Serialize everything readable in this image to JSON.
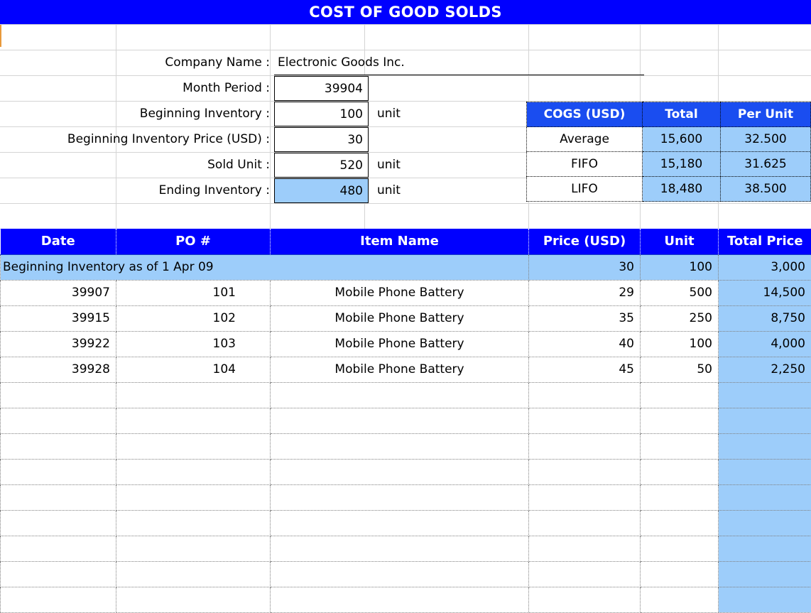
{
  "title": "COST OF GOOD SOLDS",
  "form": {
    "rows": [
      {
        "label": "Company Name :",
        "value": "Electronic Goods Inc.",
        "unit": "",
        "style": "text"
      },
      {
        "label": "Month Period :",
        "value": "39904",
        "unit": "",
        "style": "num"
      },
      {
        "label": "Beginning Inventory :",
        "value": "100",
        "unit": "unit",
        "style": "num"
      },
      {
        "label": "Beginning Inventory Price (USD) :",
        "value": "30",
        "unit": "",
        "style": "num"
      },
      {
        "label": "Sold Unit :",
        "value": "520",
        "unit": "unit",
        "style": "num"
      },
      {
        "label": "Ending Inventory :",
        "value": "480",
        "unit": "unit",
        "style": "num-highlight"
      }
    ]
  },
  "cogs": {
    "headers": [
      "COGS (USD)",
      "Total",
      "Per Unit"
    ],
    "rows": [
      {
        "method": "Average",
        "total": "15,600",
        "per_unit": "32.500"
      },
      {
        "method": "FIFO",
        "total": "15,180",
        "per_unit": "31.625"
      },
      {
        "method": "LIFO",
        "total": "18,480",
        "per_unit": "38.500"
      }
    ]
  },
  "table": {
    "headers": [
      "Date",
      "PO #",
      "Item Name",
      "Price (USD)",
      "Unit",
      "Total Price"
    ],
    "beginning_row": {
      "label": "Beginning Inventory as of  1 Apr 09",
      "price": "30",
      "unit": "100",
      "total": "3,000"
    },
    "rows": [
      {
        "date": "39907",
        "po": "101",
        "item": "Mobile Phone Battery",
        "price": "29",
        "unit": "500",
        "total": "14,500"
      },
      {
        "date": "39915",
        "po": "102",
        "item": "Mobile Phone Battery",
        "price": "35",
        "unit": "250",
        "total": "8,750"
      },
      {
        "date": "39922",
        "po": "103",
        "item": "Mobile Phone Battery",
        "price": "40",
        "unit": "100",
        "total": "4,000"
      },
      {
        "date": "39928",
        "po": "104",
        "item": "Mobile Phone Battery",
        "price": "45",
        "unit": "50",
        "total": "2,250"
      }
    ],
    "empty_row_count": 9
  },
  "colors": {
    "title_blue": "#0000FF",
    "header_blue": "#1A4DF0",
    "fill_light_blue": "#9DCDFA",
    "marker_orange": "#E8993B"
  }
}
